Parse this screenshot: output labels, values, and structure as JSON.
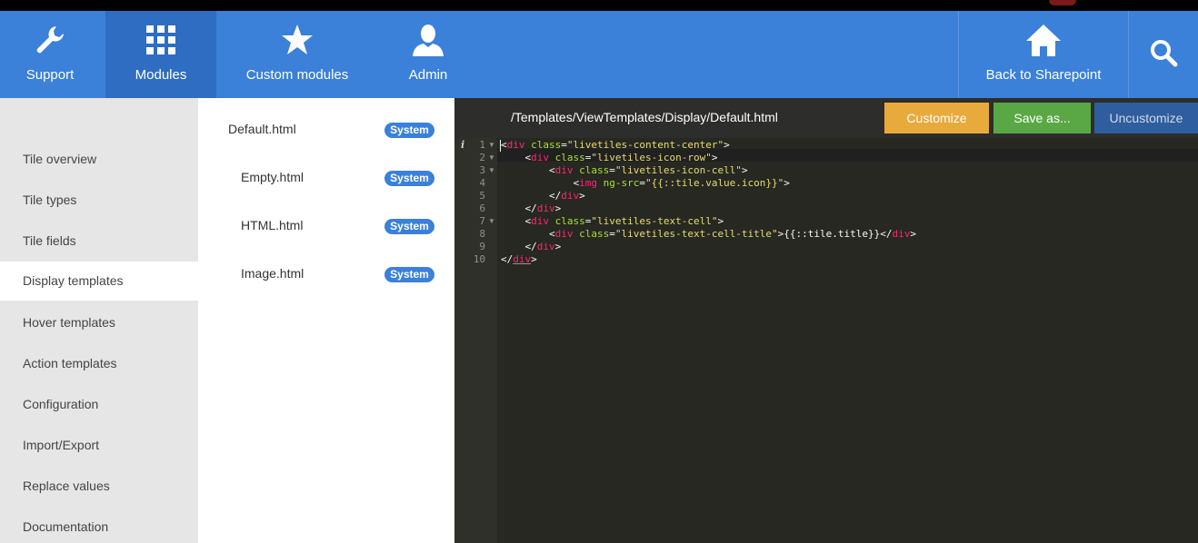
{
  "nav": {
    "items": [
      {
        "label": "Support",
        "icon": "wrench-icon"
      },
      {
        "label": "Modules",
        "icon": "grid-icon"
      },
      {
        "label": "Custom modules",
        "icon": "star-icon"
      },
      {
        "label": "Admin",
        "icon": "user-icon"
      }
    ],
    "back_label": "Back to Sharepoint",
    "search_icon": "search-icon",
    "accent_color": "#3b80d9"
  },
  "sidebar": {
    "items": [
      {
        "label": "Tile overview"
      },
      {
        "label": "Tile types"
      },
      {
        "label": "Tile fields"
      },
      {
        "label": "Display templates"
      },
      {
        "label": "Hover templates"
      },
      {
        "label": "Action templates"
      },
      {
        "label": "Configuration"
      },
      {
        "label": "Import/Export"
      },
      {
        "label": "Replace values"
      },
      {
        "label": "Documentation"
      }
    ],
    "selected": "Display templates"
  },
  "files": [
    {
      "name": "Default.html",
      "badge": "System"
    },
    {
      "name": "Empty.html",
      "badge": "System"
    },
    {
      "name": "HTML.html",
      "badge": "System"
    },
    {
      "name": "Image.html",
      "badge": "System"
    }
  ],
  "editor": {
    "path": "/Templates/ViewTemplates/Display/Default.html",
    "buttons": {
      "customize": "Customize",
      "save_as": "Save as...",
      "uncustomize": "Uncustomize"
    },
    "info_glyph": "i",
    "line_numbers": [
      "1",
      "2",
      "3",
      "4",
      "5",
      "6",
      "7",
      "8",
      "9",
      "10"
    ],
    "lines": [
      "<div class=\"livetiles-content-center\">",
      "    <div class=\"livetiles-icon-row\">",
      "        <div class=\"livetiles-icon-cell\">",
      "            <img ng-src=\"{{::tile.value.icon}}\">",
      "        </div>",
      "    </div>",
      "    <div class=\"livetiles-text-cell\">",
      "        <div class=\"livetiles-text-cell-title\">{{::tile.title}}</div>",
      "    </div>",
      "</div>"
    ],
    "colors": {
      "tag": "#f92672",
      "attr": "#a6e22e",
      "string": "#e6db74",
      "bg": "#272822"
    }
  }
}
